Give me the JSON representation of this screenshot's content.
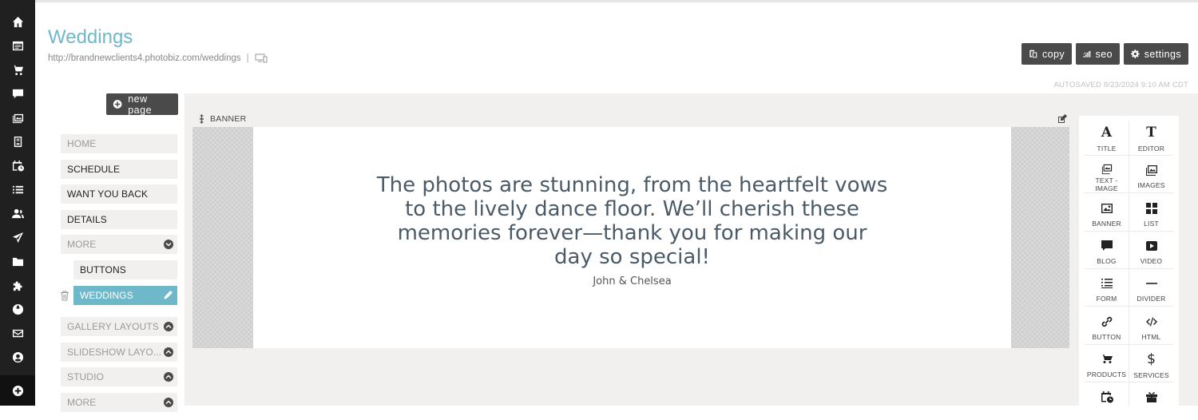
{
  "page": {
    "title": "Weddings",
    "url": "http://brandnewclients4.photobiz.com/weddings",
    "url_separator": "|",
    "autosaved": "AUTOSAVED 8/23/2024 9:10 AM CDT"
  },
  "toolbar": {
    "copy_label": "copy",
    "seo_label": "seo",
    "settings_label": "settings"
  },
  "sidebar": {
    "new_page_label": "new page",
    "items": [
      {
        "label": "HOME"
      },
      {
        "label": "SCHEDULE"
      },
      {
        "label": "WANT YOU BACK"
      },
      {
        "label": "DETAILS"
      },
      {
        "label": "MORE"
      },
      {
        "label": "BUTTONS"
      },
      {
        "label": "WEDDINGS"
      },
      {
        "label": "GALLERY LAYOUTS"
      },
      {
        "label": "SLIDESHOW LAYO..."
      },
      {
        "label": "STUDIO"
      },
      {
        "label": "MORE"
      }
    ]
  },
  "banner": {
    "section_label": "BANNER",
    "quote": "The photos are stunning, from the heartfelt vows to the lively dance floor. We’ll cherish these memories forever—thank you for making our day so special!",
    "byline": "John & Chelsea"
  },
  "palette": {
    "items": [
      {
        "label": "TITLE",
        "icon": "title-icon"
      },
      {
        "label": "EDITOR",
        "icon": "editor-icon"
      },
      {
        "label": "TEXT - IMAGE",
        "icon": "text-image-icon"
      },
      {
        "label": "IMAGES",
        "icon": "images-icon"
      },
      {
        "label": "BANNER",
        "icon": "banner-icon"
      },
      {
        "label": "LIST",
        "icon": "list-icon"
      },
      {
        "label": "BLOG",
        "icon": "blog-icon"
      },
      {
        "label": "VIDEO",
        "icon": "video-icon"
      },
      {
        "label": "FORM",
        "icon": "form-icon"
      },
      {
        "label": "DIVIDER",
        "icon": "divider-icon"
      },
      {
        "label": "BUTTON",
        "icon": "link-icon"
      },
      {
        "label": "HTML",
        "icon": "code-icon"
      },
      {
        "label": "PRODUCTS",
        "icon": "cart-icon"
      },
      {
        "label": "SERVICES",
        "icon": "dollar-icon"
      },
      {
        "label": "",
        "icon": "calendar-icon"
      },
      {
        "label": "",
        "icon": "gift-icon"
      }
    ]
  },
  "colors": {
    "accent": "#6fb8c9",
    "rail": "#202020",
    "button": "#4a4a4a"
  }
}
